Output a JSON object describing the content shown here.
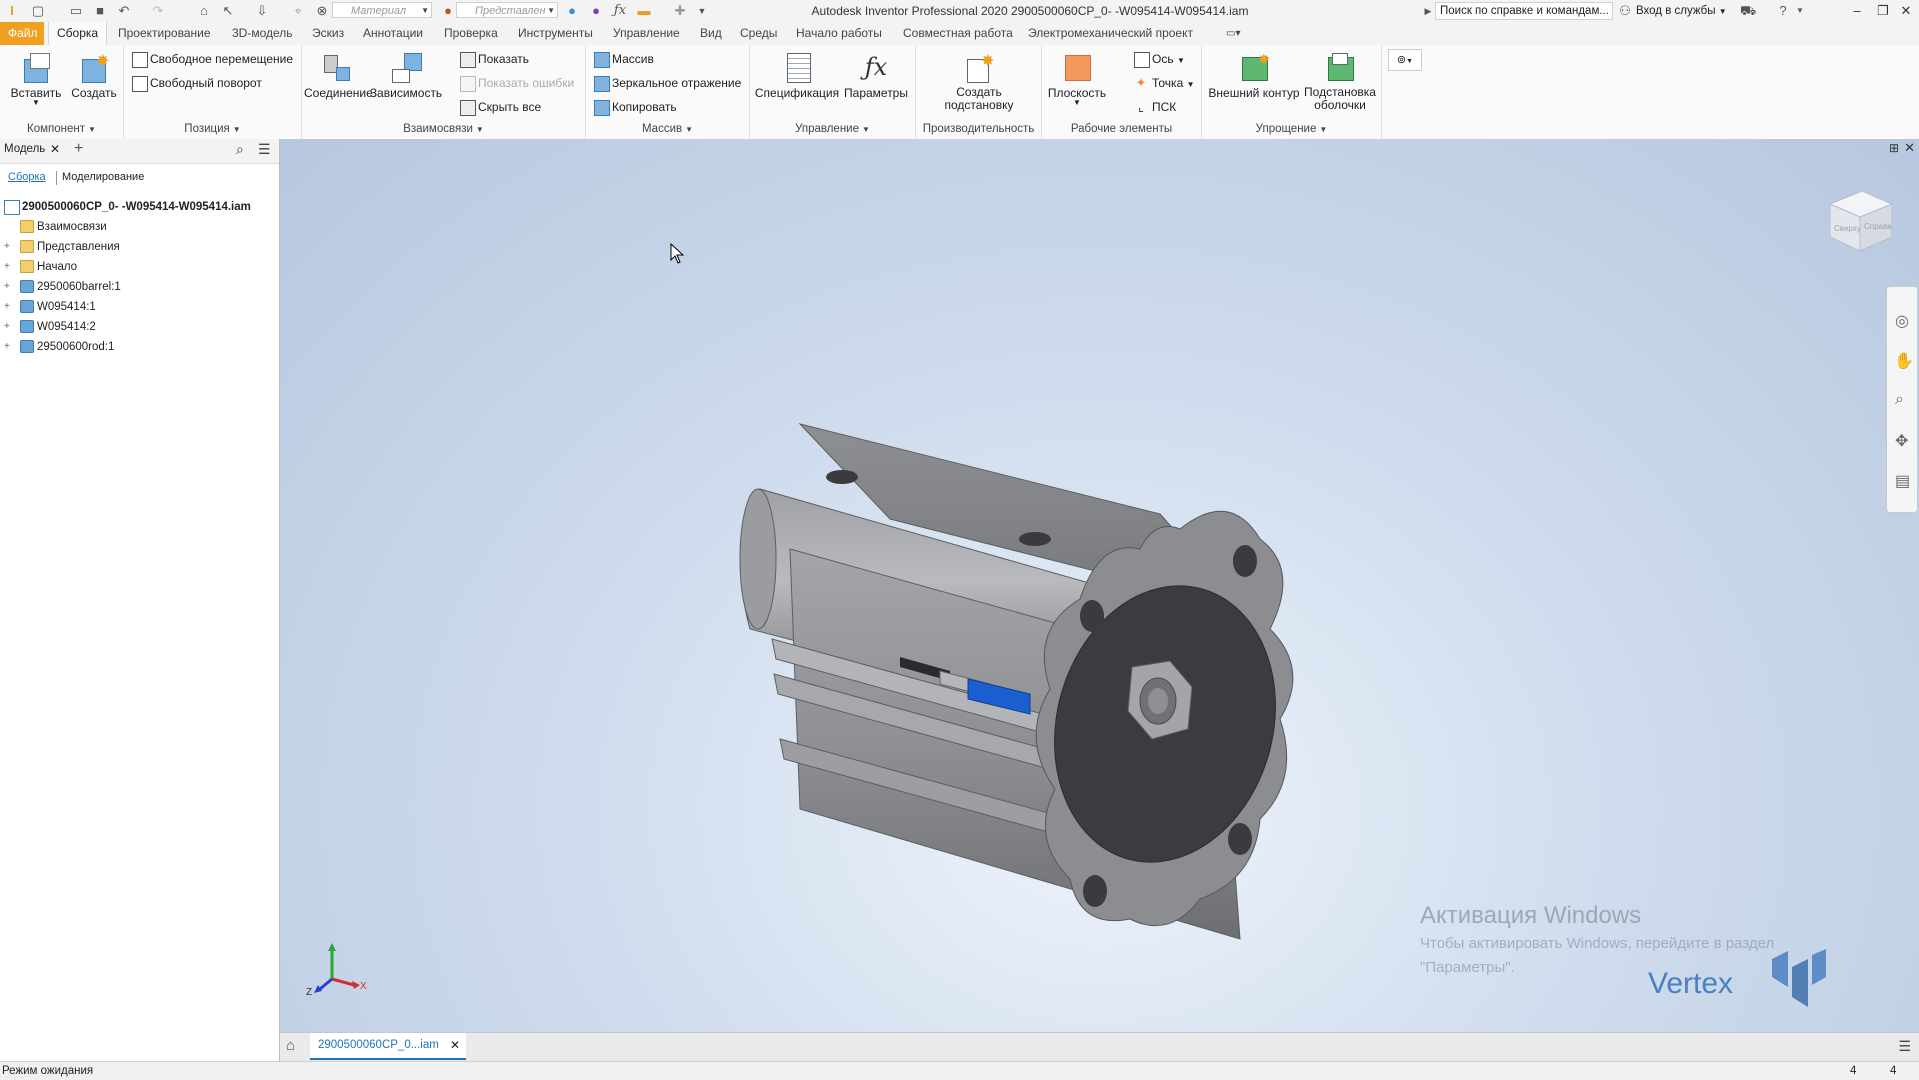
{
  "titlebar": {
    "app_title": "Autodesk Inventor Professional 2020   2900500060CP_0- -W095414-W095414.iam",
    "material_combo": "Материал",
    "appearance_combo": "Представлен",
    "help_search": "Поиск по справке и командам...",
    "signin": "Вход в службы"
  },
  "menu": {
    "file": "Файл",
    "tabs": [
      "Сборка",
      "Проектирование",
      "3D-модель",
      "Эскиз",
      "Аннотации",
      "Проверка",
      "Инструменты",
      "Управление",
      "Вид",
      "Среды",
      "Начало работы",
      "Совместная работа",
      "Электромеханический проект"
    ]
  },
  "ribbon": {
    "component": {
      "title": "Компонент",
      "insert": "Вставить",
      "create": "Создать"
    },
    "position": {
      "title": "Позиция",
      "free_move": "Свободное перемещение",
      "free_rotate": "Свободный поворот"
    },
    "relationships": {
      "title": "Взаимосвязи",
      "joint": "Соединение",
      "constrain": "Зависимость",
      "show": "Показать",
      "show_errors": "Показать ошибки",
      "hide_all": "Скрыть все"
    },
    "pattern": {
      "title": "Массив",
      "pattern": "Массив",
      "mirror": "Зеркальное отражение",
      "copy": "Копировать"
    },
    "manage": {
      "title": "Управление",
      "bom": "Спецификация",
      "params": "Параметры"
    },
    "productivity": {
      "title": "Производительность",
      "create_sub_1": "Создать",
      "create_sub_2": "подстановку"
    },
    "work_features": {
      "title": "Рабочие элементы",
      "plane": "Плоскость",
      "axis": "Ось",
      "point": "Точка",
      "ucs": "ПСК"
    },
    "simplify": {
      "title": "Упрощение",
      "envelope": "Внешний контур",
      "shrinkwrap_1": "Подстановка",
      "shrinkwrap_2": "оболочки"
    }
  },
  "browser": {
    "tab": "Модель",
    "sub_assembly": "Сборка",
    "sub_modeling": "Моделирование",
    "root": "2900500060CP_0- -W095414-W095414.iam",
    "items": [
      "Взаимосвязи",
      "Представления",
      "Начало",
      "2950060barrel:1",
      "W095414:1",
      "W095414:2",
      "29500600rod:1"
    ]
  },
  "viewport": {
    "viewcube_top": "Сверху",
    "viewcube_front": "Справа",
    "watermark_title": "Активация Windows",
    "watermark_line1": "Чтобы активировать Windows, перейдите в раздел",
    "watermark_line2": "\"Параметры\".",
    "logo": "Vertex",
    "axis_x": "X",
    "axis_z": "Z"
  },
  "doc_tab": "2900500060CP_0...iam",
  "status": {
    "text": "Режим ожидания",
    "num1": "4",
    "num2": "4"
  },
  "colors": {
    "file_tab": "#f0a020",
    "accent": "#1e73be",
    "sensor": "#1a5fd0"
  }
}
